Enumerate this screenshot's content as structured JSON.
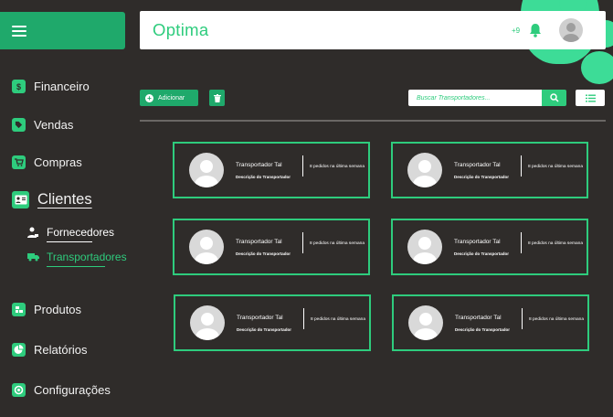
{
  "app": {
    "title": "Optima"
  },
  "colors": {
    "accent": "#2ecc7d",
    "accent_dark": "#1fa96b",
    "background": "#2f2c2a",
    "header": "#ffffff"
  },
  "header": {
    "notification_count": "+9",
    "icons": [
      "bell-icon",
      "user-avatar"
    ]
  },
  "sidebar": {
    "menu_icon": "hamburger-icon",
    "items": [
      {
        "label": "Financeiro",
        "icon": "dollar-icon"
      },
      {
        "label": "Vendas",
        "icon": "tag-icon"
      },
      {
        "label": "Compras",
        "icon": "cart-icon"
      },
      {
        "label": "Clientes",
        "icon": "id-card-icon"
      },
      {
        "label": "Produtos",
        "icon": "box-icon"
      },
      {
        "label": "Relatórios",
        "icon": "chart-icon"
      },
      {
        "label": "Configurações",
        "icon": "gear-icon"
      }
    ],
    "sub_items": [
      {
        "label": "Fornecedores",
        "icon": "user-tie-icon",
        "active": false
      },
      {
        "label": "Transportadores",
        "icon": "truck-icon",
        "active": true
      }
    ]
  },
  "toolbar": {
    "add_label": "Adicionar",
    "search_placeholder": "Buscar Transportadores..."
  },
  "cards": [
    {
      "name": "Transportador Tal",
      "description": "Descrição do Transportador",
      "orders": "8 pedidos na última semana"
    },
    {
      "name": "Transportador Tal",
      "description": "Descrição do Transportador",
      "orders": "8 pedidos na última semana"
    },
    {
      "name": "Transportador Tal",
      "description": "Descrição do Transportador",
      "orders": "8 pedidos na última semana"
    },
    {
      "name": "Transportador Tal",
      "description": "Descrição do Transportador",
      "orders": "8 pedidos na última semana"
    },
    {
      "name": "Transportador Tal",
      "description": "Descrição do Transportador",
      "orders": "8 pedidos na última semana"
    },
    {
      "name": "Transportador Tal",
      "description": "Descrição do Transportador",
      "orders": "8 pedidos na última semana"
    }
  ]
}
